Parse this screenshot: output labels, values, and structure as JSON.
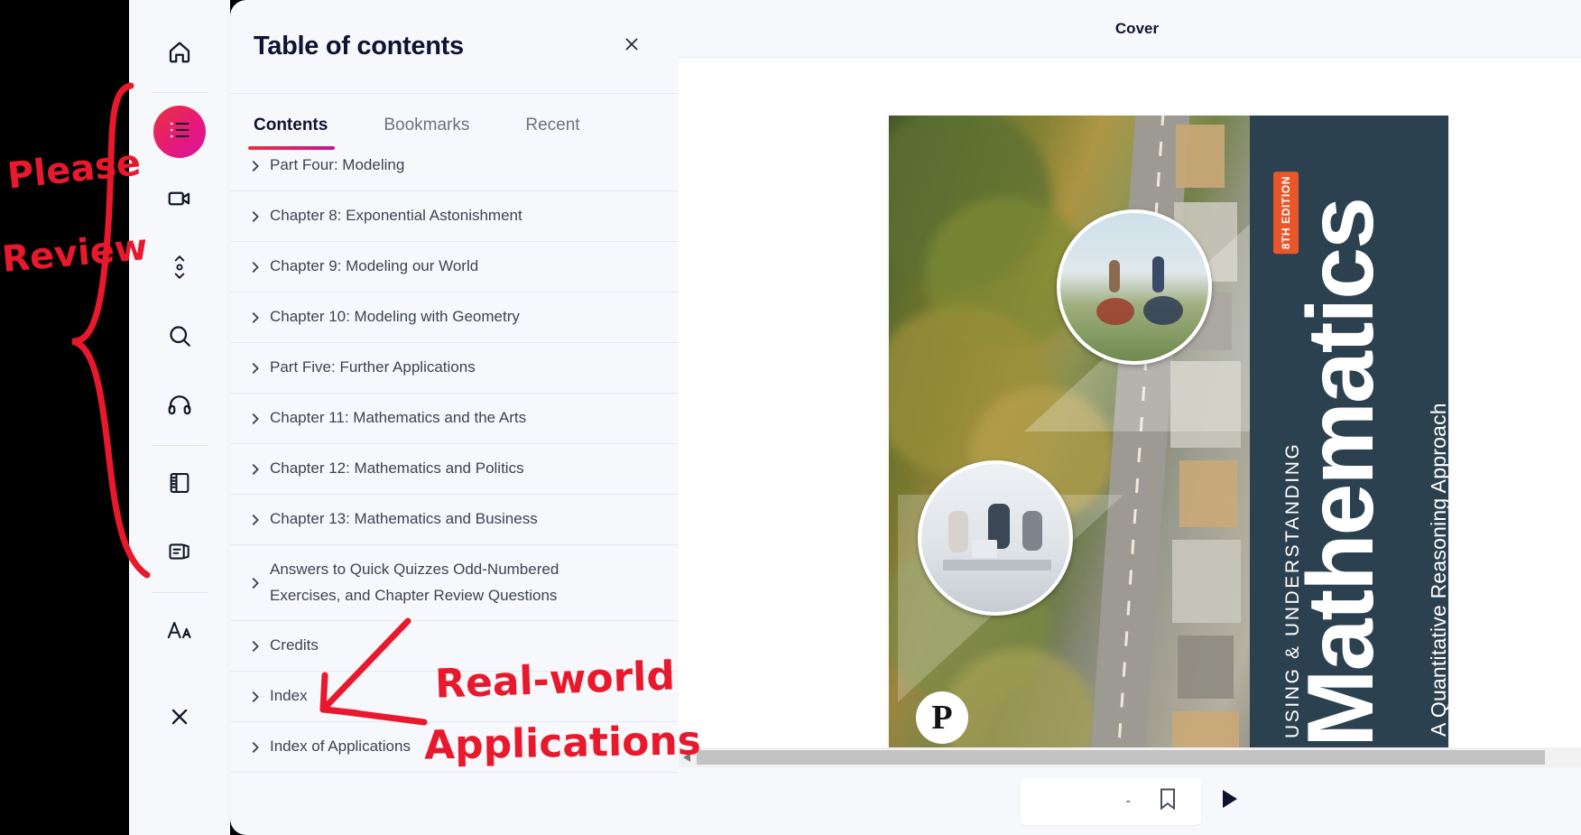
{
  "app": {
    "background_color": "#f7f8fc",
    "accent_gradient_start": "#e8323c",
    "accent_gradient_end": "#c01894"
  },
  "sidebar": {
    "items": [
      {
        "name": "home-icon",
        "label": "Home",
        "active": false
      },
      {
        "name": "table-of-contents-icon",
        "label": "Table of contents",
        "active": true
      },
      {
        "name": "video-icon",
        "label": "Video",
        "active": false
      },
      {
        "name": "scroll-mode-icon",
        "label": "Scroll mode",
        "active": false
      },
      {
        "name": "search-icon",
        "label": "Search",
        "active": false
      },
      {
        "name": "headphones-icon",
        "label": "Audio",
        "active": false
      },
      {
        "name": "notebook-icon",
        "label": "Notebook",
        "active": false
      },
      {
        "name": "flashcards-icon",
        "label": "Flashcards",
        "active": false
      },
      {
        "name": "text-size-icon",
        "label": "Text size",
        "active": false
      }
    ],
    "close_label": "Close"
  },
  "toc": {
    "title": "Table of contents",
    "close_label": "Close",
    "tabs": [
      {
        "label": "Contents",
        "active": true
      },
      {
        "label": "Bookmarks",
        "active": false
      },
      {
        "label": "Recent",
        "active": false
      }
    ],
    "items": [
      {
        "label": "Part Four: Modeling"
      },
      {
        "label": "Chapter 8: Exponential Astonishment"
      },
      {
        "label": "Chapter 9: Modeling our World"
      },
      {
        "label": "Chapter 10: Modeling with Geometry"
      },
      {
        "label": "Part Five: Further Applications"
      },
      {
        "label": "Chapter 11: Mathematics and the Arts"
      },
      {
        "label": "Chapter 12: Mathematics and Politics"
      },
      {
        "label": "Chapter 13: Mathematics and Business"
      },
      {
        "label": "Answers to Quick Quizzes Odd-Numbered Exercises, and Chapter Review Questions"
      },
      {
        "label": "Credits"
      },
      {
        "label": "Index"
      },
      {
        "label": "Index of Applications"
      }
    ]
  },
  "reader": {
    "page_title": "Cover",
    "page_number": "-",
    "bookmark_label": "Bookmark",
    "next_page_label": "Next page",
    "scroll_left_label": "Scroll left"
  },
  "cover": {
    "series_line": "USING & UNDERSTANDING",
    "main_title": "Mathematics",
    "subtitle": "A Quantitative Reasoning Approach",
    "edition_badge": "8TH EDITION",
    "publisher_mark": "P",
    "spine_color": "#2c4150",
    "badge_color": "#e8562a"
  },
  "annotations": [
    {
      "text": "Please",
      "color": "#e8192c"
    },
    {
      "text": "Review",
      "color": "#e8192c"
    },
    {
      "text": "Real-world",
      "color": "#e8192c"
    },
    {
      "text": "Applications",
      "color": "#e8192c"
    }
  ]
}
